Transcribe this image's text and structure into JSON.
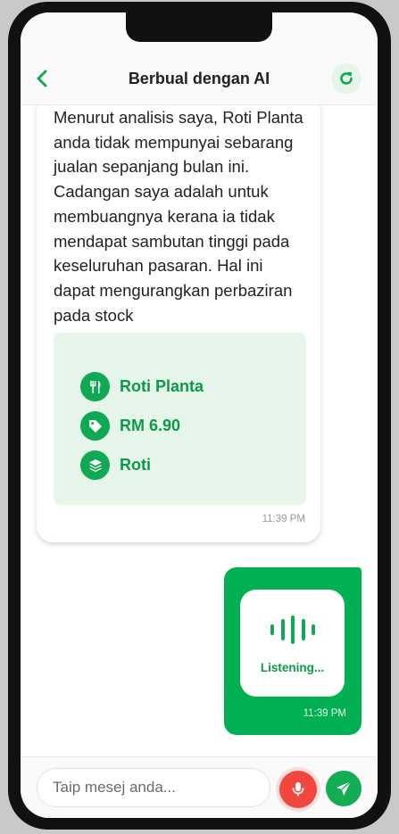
{
  "header": {
    "title": "Berbual dengan AI",
    "back_icon": "chevron-left-icon",
    "refresh_icon": "refresh-icon"
  },
  "bot_message": {
    "text": "Menurut analisis saya, Roti Planta anda tidak mempunyai sebarang jualan sepanjang bulan ini. Cadangan saya adalah untuk membuangnya kerana ia tidak mendapat sambutan tinggi pada keseluruhan pasaran. Hal ini dapat mengurangkan perbaziran pada stock",
    "product": {
      "name": "Roti Planta",
      "price": "RM 6.90",
      "category": "Roti",
      "name_icon": "utensils-icon",
      "price_icon": "tag-icon",
      "category_icon": "layers-icon"
    },
    "time": "11:39 PM"
  },
  "user_message": {
    "status": "Listening...",
    "icon": "audio-wave-icon",
    "time": "11:39 PM"
  },
  "composer": {
    "placeholder": "Taip mesej anda...",
    "value": "",
    "mic_icon": "microphone-icon",
    "send_icon": "send-icon"
  },
  "colors": {
    "accent": "#0fa853",
    "bubble_user": "#00b052",
    "mic_active": "#f2473f",
    "product_card_bg": "#e5f5ea"
  }
}
